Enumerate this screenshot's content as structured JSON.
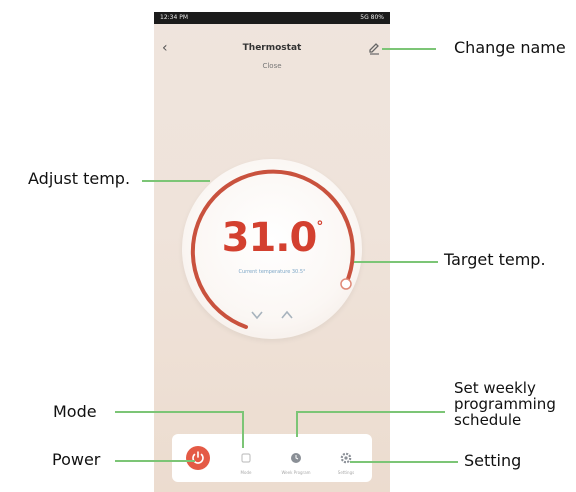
{
  "callouts": {
    "change_name": "Change name",
    "adjust_temp": "Adjust temp.",
    "target_temp": "Target temp.",
    "set_weekly_line1": "Set weekly",
    "set_weekly_line2": "programming",
    "set_weekly_line3": "schedule",
    "mode": "Mode",
    "power": "Power",
    "setting": "Setting"
  },
  "phone": {
    "status_left": "12:34 PM",
    "status_right": "5G 80%",
    "title": "Thermostat",
    "subtitle": "Close",
    "temperature": "31.0",
    "unit": "°",
    "current_temp_text": "Current temperature 30.5°",
    "nav": [
      {
        "label": "",
        "icon": "power-icon"
      },
      {
        "label": "Mode",
        "icon": "mode-icon"
      },
      {
        "label": "Week Program",
        "icon": "schedule-icon"
      },
      {
        "label": "Settings",
        "icon": "gear-icon"
      }
    ]
  },
  "colors": {
    "accent": "#d3402f",
    "callout_line": "#7cc576",
    "power": "#e45a45"
  }
}
